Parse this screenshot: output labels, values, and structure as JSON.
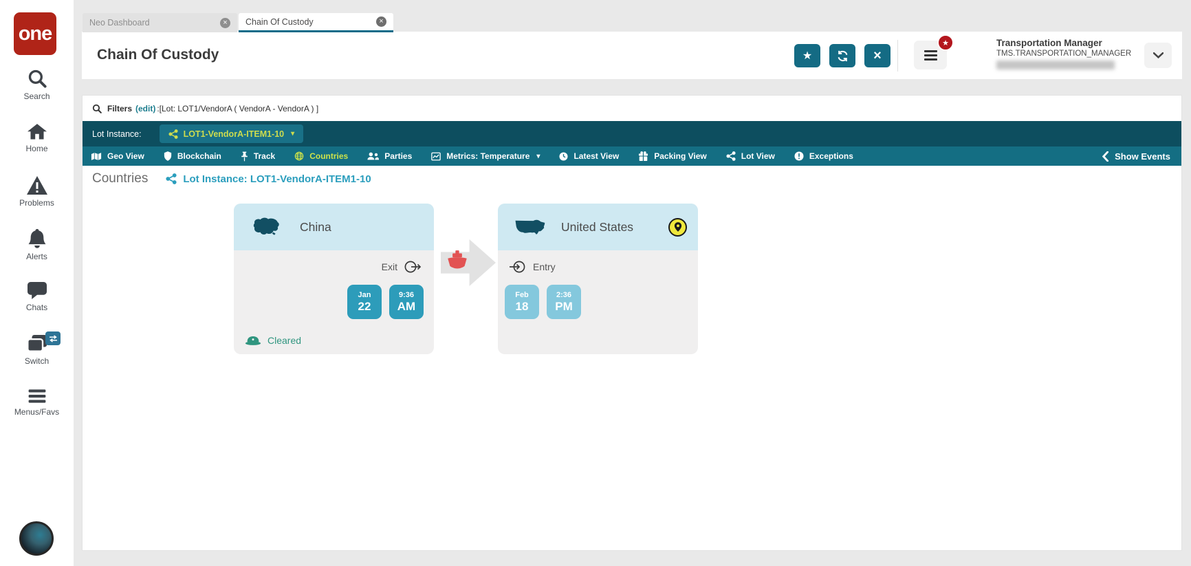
{
  "app": {
    "logo": "one"
  },
  "sidebar": {
    "items": [
      {
        "label": "Search"
      },
      {
        "label": "Home"
      },
      {
        "label": "Problems"
      },
      {
        "label": "Alerts"
      },
      {
        "label": "Chats"
      },
      {
        "label": "Switch"
      },
      {
        "label": "Menus/Favs"
      }
    ]
  },
  "tabs": [
    {
      "label": "Neo Dashboard",
      "active": false
    },
    {
      "label": "Chain Of Custody",
      "active": true
    }
  ],
  "header": {
    "title": "Chain Of Custody",
    "user": {
      "role": "Transportation Manager",
      "login": "TMS.TRANSPORTATION_MANAGER"
    }
  },
  "filters": {
    "label": "Filters",
    "edit": "(edit)",
    "value": ":[Lot: LOT1/VendorA ( VendorA - VendorA ) ]"
  },
  "lot_bar": {
    "label": "Lot Instance:",
    "selected": "LOT1-VendorA-ITEM1-10"
  },
  "nav": {
    "items": [
      {
        "label": "Geo View",
        "icon": "map-icon",
        "active": false
      },
      {
        "label": "Blockchain",
        "icon": "shield-icon",
        "active": false
      },
      {
        "label": "Track",
        "icon": "thumbtack-icon",
        "active": false
      },
      {
        "label": "Countries",
        "icon": "globe-icon",
        "active": true
      },
      {
        "label": "Parties",
        "icon": "users-icon",
        "active": false
      },
      {
        "label": "Metrics: Temperature",
        "icon": "chart-icon",
        "active": false,
        "has_caret": true
      },
      {
        "label": "Latest View",
        "icon": "clock-icon",
        "active": false
      },
      {
        "label": "Packing View",
        "icon": "packing-icon",
        "active": false
      },
      {
        "label": "Lot View",
        "icon": "share-icon",
        "active": false
      },
      {
        "label": "Exceptions",
        "icon": "exclamation-icon",
        "active": false
      }
    ],
    "show_events": "Show Events"
  },
  "content": {
    "heading": "Countries",
    "lot_link": "Lot Instance: LOT1-VendorA-ITEM1-10",
    "cards": [
      {
        "country": "China",
        "direction": "Exit",
        "month": "Jan",
        "day": "22",
        "time": "9:36",
        "meridiem": "AM",
        "status": "Cleared"
      },
      {
        "country": "United States",
        "direction": "Entry",
        "month": "Feb",
        "day": "18",
        "time": "2:36",
        "meridiem": "PM"
      }
    ],
    "transport": "ship"
  },
  "icons": {
    "star": "★",
    "close": "×",
    "tab_close": "×",
    "caret_down": "▾"
  },
  "colors": {
    "brand_red": "#b02418",
    "dark_teal": "#0d4e5f",
    "nav_teal": "#146e83",
    "accent_button_teal": "#146b84",
    "active_yellow_green": "#cde24a",
    "link_teal": "#2b9ebd",
    "card_header_blue": "#cfe9f2",
    "tile_teal": "#2d9cba",
    "tile_light_blue": "#84c8dd",
    "status_green": "#2f957f",
    "ship_red": "#e25353",
    "badge_yellow": "#f0e83c",
    "notification_red": "#b3161d"
  }
}
